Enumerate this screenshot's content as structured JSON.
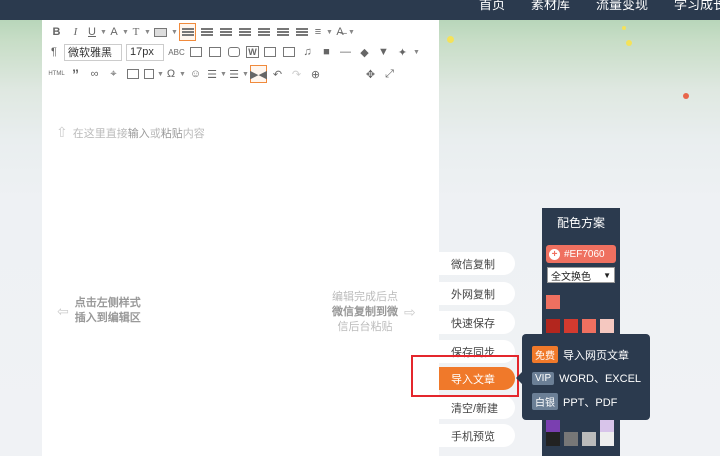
{
  "topnav": [
    "首页",
    "素材库",
    "流量变现",
    "学习成长"
  ],
  "toolbar": {
    "font_family": "微软雅黑",
    "font_size": "17px"
  },
  "editor": {
    "placeholder_pre": "在这里直接",
    "placeholder_bold1": "输入",
    "placeholder_mid": "或",
    "placeholder_bold2": "粘贴",
    "placeholder_post": "内容",
    "hint_left_line1": "点击左侧样式",
    "hint_left_line2": "插入到编辑区",
    "hint_right_line1": "编辑完成后点",
    "hint_right_line2": "微信复制到微",
    "hint_right_line3": "信后台粘贴"
  },
  "side_menu": [
    "微信复制",
    "外网复制",
    "快速保存",
    "保存同步",
    "导入文章",
    "清空/新建",
    "手机预览"
  ],
  "palette": {
    "title": "配色方案",
    "hex": "#EF7060",
    "select_value": "全文换色"
  },
  "import_popup": [
    {
      "tag": "免费",
      "label": "导入网页文章",
      "tag_color": "#f0792a"
    },
    {
      "tag": "VIP",
      "label": "WORD、EXCEL",
      "tag_color": "#6b7f96"
    },
    {
      "tag": "白银",
      "label": "PPT、PDF",
      "tag_color": "#6b7f96"
    }
  ],
  "colors": {
    "accent": "#f0792a",
    "nav_bg": "#2b3a4e",
    "highlight_box": "#e4262c"
  }
}
